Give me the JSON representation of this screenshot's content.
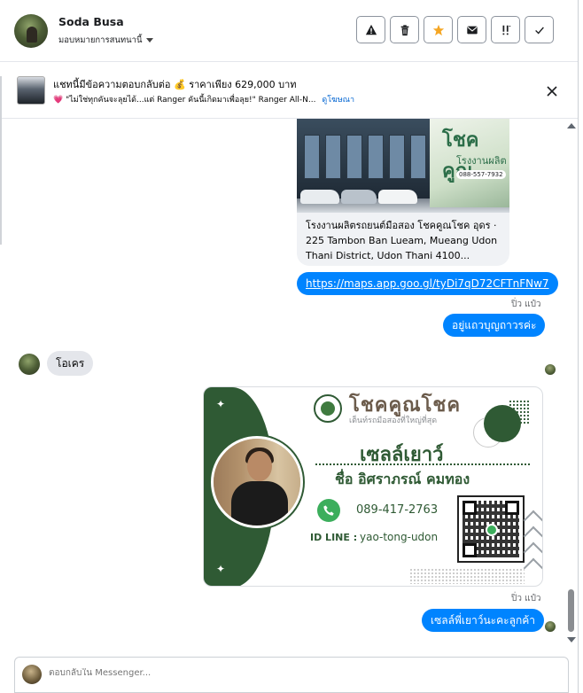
{
  "header": {
    "name": "Soda Busa",
    "assign_label": "มอบหมายการสนทนานี้",
    "tools": [
      {
        "name": "report-icon"
      },
      {
        "name": "trash-icon"
      },
      {
        "name": "star-icon"
      },
      {
        "name": "mail-icon"
      },
      {
        "name": "priority-icon"
      },
      {
        "name": "check-icon"
      }
    ]
  },
  "ad": {
    "title": "แชทนี้มีข้อความตอบกลับต่อ 💰 ราคาเพียง 629,000 บาท",
    "snippet": "💗 \"ไม่ใช่ทุกคันจะลุยได้...แต่ Ranger คันนี้เกิดมาเพื่อลุย!\" Ranger All-N...",
    "link": "ดูโฆษณา"
  },
  "messages": {
    "location_card": {
      "banner_title": "โชคคูณ",
      "banner_sub": "โรงงานผลิต แ",
      "banner_phone": "088-557-7932",
      "text": "โรงงานผลิตรถยนต์มือสอง โชคคูณโชค อุดร · 225 Tambon Ban Lueam, Mueang Udon Thani District, Udon Thani 4100..."
    },
    "link_message": "https://maps.app.goo.gl/tyDi7qD72CFTnFNw7",
    "sender_1": "ปิ่ว แป๋ว",
    "out_1": "อยู่แถวบุญถาวรค่ะ",
    "in_1": "โอเคร",
    "sender_2": "ปิ่ว แป๋ว",
    "out_2": "เซลล์พี่เยาว์นะคะลูกค้า"
  },
  "business_card": {
    "brand": "โชคคูณโชค",
    "tagline": "เต็นท์รถมือสองที่ใหญ่ที่สุด",
    "role": "เซลล์เยาว์",
    "name": "ชื่อ อิศราภรณ์  คมทอง",
    "phone": "089-417-2763",
    "id_label": "ID LINE :",
    "id_value": "yao-tong-udon"
  },
  "composer": {
    "placeholder": "ตอบกลับใน Messenger..."
  },
  "colors": {
    "bubble_out": "#0084ff",
    "bubble_in": "#e4e6eb",
    "card_green": "#2f5a34",
    "star": "#f5a623"
  }
}
